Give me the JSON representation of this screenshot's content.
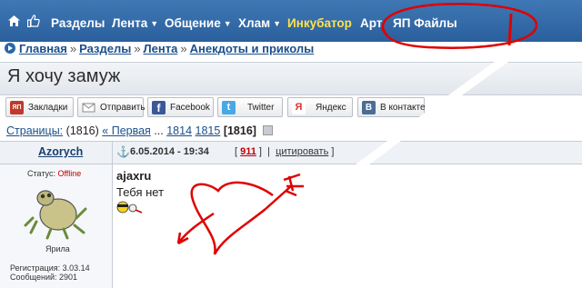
{
  "nav": {
    "items": [
      {
        "label": "Разделы",
        "caret": ""
      },
      {
        "label": "Лента",
        "caret": "▼"
      },
      {
        "label": "Общение",
        "caret": "▼"
      },
      {
        "label": "Хлам",
        "caret": "▼"
      },
      {
        "label": "Инкубатор",
        "caret": ""
      },
      {
        "label": "Арт",
        "caret": ""
      },
      {
        "label": "ЯП Файлы",
        "caret": ""
      }
    ]
  },
  "breadcrumb": [
    "Главная",
    "Разделы",
    "Лента",
    "Анекдоты и приколы"
  ],
  "breadcrumb_sep": "»",
  "page_title": "Я хочу замуж",
  "share": [
    {
      "label": "Закладки",
      "icon": "yap-icon",
      "color": "#c0392b",
      "text": "ЯП"
    },
    {
      "label": "Отправить",
      "icon": "mail-icon",
      "color": "#9aa3ad",
      "text": ""
    },
    {
      "label": "Facebook",
      "icon": "facebook-icon",
      "color": "#3b5998",
      "text": "f"
    },
    {
      "label": "Twitter",
      "icon": "twitter-icon",
      "color": "#48a9e6",
      "text": "t"
    },
    {
      "label": "Яндекс",
      "icon": "yandex-icon",
      "color": "#d33",
      "text": "Я"
    },
    {
      "label": "В контакте",
      "icon": "vk-icon",
      "color": "#4a6d96",
      "text": "В"
    }
  ],
  "pages": {
    "label": "Страницы:",
    "total": "(1816)",
    "first": "« Первая",
    "ellipsis": "...",
    "p1": "1814",
    "p2": "1815",
    "current": "[1816]"
  },
  "post": {
    "author": "Azorych",
    "date": "6.05.2014 - 19:34",
    "number": "911",
    "quote": "цитировать",
    "status_label": "Статус:",
    "status_value": "Offline",
    "nick": "Ярила",
    "reg_label": "Регистрация:",
    "reg_value": "3.03.14",
    "msgs_label": "Сообщений:",
    "msgs_value": "2901",
    "quoted_user": "ajaxru",
    "text": "Тебя нет"
  },
  "colors": {
    "nav_bg": "#2a5f9c",
    "incubator": "#ffe14d",
    "link": "#1a4f8b",
    "accent_red": "#c00000",
    "scribble_red": "#e00000"
  }
}
